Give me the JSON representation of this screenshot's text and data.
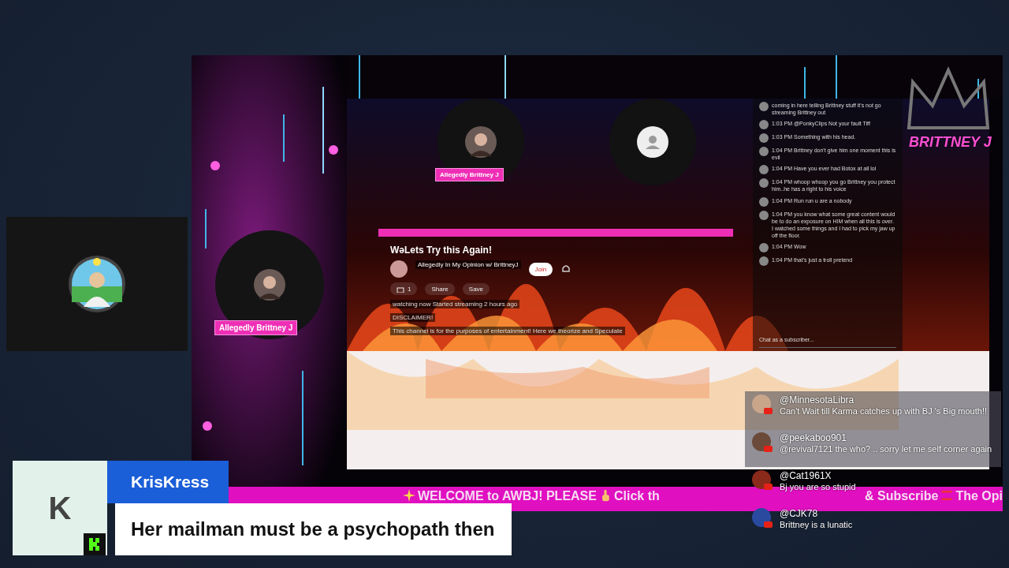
{
  "stream": {
    "guest_label": "Allegedly Brittney J",
    "brand": "BRITTNEY J",
    "embedded_page": {
      "host_label": "Allegedly Brittney J",
      "title": "WəLets Try this Again!",
      "channel": "Allegedly In My Opinion w/ BrittneyJ",
      "join": "Join",
      "likes": "1",
      "actions": [
        "Share",
        "Save"
      ],
      "status": "watching now  Started streaming 2 hours ago",
      "disclaimer": "DISCLAIMER!",
      "description": "This channel is for the purposes of entertainment!  Here we theorize and Speculate",
      "chat": [
        {
          "text": "coming in here telling Brittney stuff it's not go streaming Brittney out"
        },
        {
          "time": "1:03 PM",
          "author": "@PonkyClips",
          "text": "Not your fault Tiff"
        },
        {
          "time": "1:03 PM",
          "text": "Something with his head."
        },
        {
          "time": "1:04 PM",
          "text": "Brittney don't give him one moment this is evil"
        },
        {
          "time": "1:04 PM",
          "text": "Have you ever had Botox at all lol"
        },
        {
          "time": "1:04 PM",
          "text": "whoop whoop you go Brittney you protect him..he has a right to his voice"
        },
        {
          "time": "1:04 PM",
          "text": "Run run u are a nobody"
        },
        {
          "time": "1:04 PM",
          "text": "you know what some great content would be to do an exposure on HIM when all this is over. I watched some things and I had to pick my jaw up off the floor."
        },
        {
          "time": "1:04 PM",
          "text": "Wow"
        },
        {
          "time": "1:04 PM",
          "text": "that's just a troll pretend"
        }
      ],
      "chat_placeholder": "Chat as a subscriber..."
    }
  },
  "ticker": {
    "parts": [
      "WELCOME to AWBJ! PLEASE",
      "Click th",
      "& Subscribe",
      "The Opi"
    ]
  },
  "overlay_chat": [
    {
      "author": "@MinnesotaLibra",
      "text": "Can't Wait till Karma catches up with BJ 's Big mouth!!",
      "on_panel": true
    },
    {
      "author": "@peekaboo901",
      "text": "@revival7121 the who? .. sorry let me self corner again",
      "on_panel": true
    },
    {
      "author": "@Cat1961X",
      "text": "Bj you are so stupid",
      "on_panel": false
    },
    {
      "author": "@CJK78",
      "text": "Brittney is a lunatic",
      "on_panel": false
    }
  ],
  "highlight": {
    "initial": "K",
    "name": "KrisKress",
    "message": "Her mailman must be a psychopath then"
  }
}
